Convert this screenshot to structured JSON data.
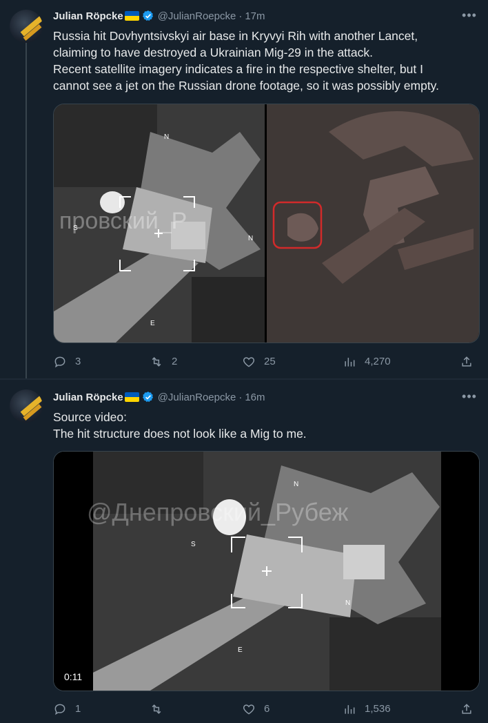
{
  "tweets": [
    {
      "author": {
        "name": "Julian Röpcke",
        "handle": "@JulianRoepcke"
      },
      "time": "17m",
      "text_lines": [
        "Russia hit Dovhyntsivskyi air base in Kryvyi Rih with another Lancet,",
        "claiming to have destroyed a Ukrainian Mig-29 in the attack.",
        "Recent satellite imagery indicates a fire in the respective shelter, but I",
        "cannot see a jet on the Russian drone footage, so it was possibly empty."
      ],
      "media": {
        "type": "two-images",
        "left_image_labels": {
          "north": "N",
          "south": "S",
          "east": "E",
          "watermark": "провский_Р"
        },
        "right_image": {
          "highlight_color": "#d22a2a"
        }
      },
      "stats": {
        "replies": "3",
        "reposts": "2",
        "likes": "25",
        "views": "4,270"
      }
    },
    {
      "author": {
        "name": "Julian Röpcke",
        "handle": "@JulianRoepcke"
      },
      "time": "16m",
      "text_lines": [
        "Source video:",
        "The hit structure does not look like a Mig to me."
      ],
      "media": {
        "type": "video",
        "duration": "0:11",
        "labels": {
          "north": "N",
          "south": "S",
          "east": "E",
          "watermark": "@Днепровский_Рубеж"
        }
      },
      "stats": {
        "replies": "1",
        "reposts": "",
        "likes": "6",
        "views": "1,536"
      }
    }
  ],
  "colors": {
    "background": "#15202b",
    "text": "#e7e9ea",
    "muted": "#8b98a5",
    "verified": "#1d9bf0"
  }
}
